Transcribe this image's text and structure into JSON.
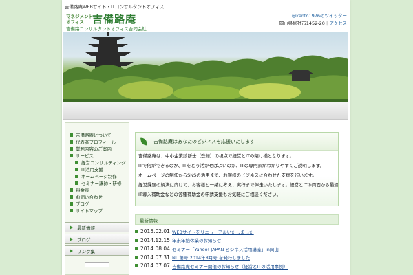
{
  "header": {
    "tagline": "吉備路庵WEBサイト・ITコンサルタントオフィス",
    "logo_small_line1": "マネジメント",
    "logo_small_line2": "オフィス",
    "logo_title": "吉備路庵",
    "company_name": "吉備路コンサルタントオフィス合同会社",
    "twitter": "@kento1976のツイッター",
    "contact_text": "岡山県総社市1452-20",
    "contact_sep": "|",
    "contact_link": "アクセス"
  },
  "sidebar": {
    "items": [
      {
        "label": "吉備路庵について",
        "sub": false
      },
      {
        "label": "代表者プロフィール",
        "sub": false
      },
      {
        "label": "業務内容のご案内",
        "sub": false
      },
      {
        "label": "サービス",
        "sub": false
      },
      {
        "label": "経営コンサルティング",
        "sub": true
      },
      {
        "label": "IT活用支援",
        "sub": true
      },
      {
        "label": "ホームページ制作",
        "sub": true
      },
      {
        "label": "セミナー講師・研修",
        "sub": true
      },
      {
        "label": "料金表",
        "sub": false
      },
      {
        "label": "お問い合わせ",
        "sub": false
      },
      {
        "label": "ブログ",
        "sub": false
      },
      {
        "label": "サイトマップ",
        "sub": false
      }
    ],
    "sections": [
      "最新情報",
      "ブログ",
      "リンク集"
    ]
  },
  "main": {
    "info_heading": "吉備路庵はあなたのビジネスを応援いたします",
    "paragraphs": [
      "吉備路庵は、中小企業診断士（登録）の視点で経営とITの架け橋となります。",
      "ITで何ができるのか、ITをどう活かせばよいのか、ITの専門家がわかりやすくご説明します。",
      "ホームページの制作からSNSの活用まで、お客様のビジネスに合わせた支援を行います。",
      "経営課題の解決に向けて、お客様と一緒に考え、実行まで伴走いたします。経営とITの両面から最適なご提案をいたします。",
      "IT導入補助金などの各種補助金の申請支援もお気軽にご相談ください。"
    ],
    "news_heading": "最新情報",
    "news": [
      {
        "date": "2015.02.01",
        "title": "WEBサイトをリニューアルいたしました"
      },
      {
        "date": "2014.12.15",
        "title": "年末年始休業のお知らせ"
      },
      {
        "date": "2014.08.04",
        "title": "セミナー「Yahoo! JAPAN ビジネス活用講座」in岡山"
      },
      {
        "date": "2014.07.31",
        "title": "NL 第号 2014年8月号 を発行しました"
      },
      {
        "date": "2014.07.07",
        "title": "吉備路庵セミナー開催のお知らせ（経営とITの活用事例）"
      }
    ]
  },
  "colors": {
    "accent_green": "#3f8f33",
    "link_blue": "#1b4d8f",
    "page_bg": "#d9ecd2"
  }
}
